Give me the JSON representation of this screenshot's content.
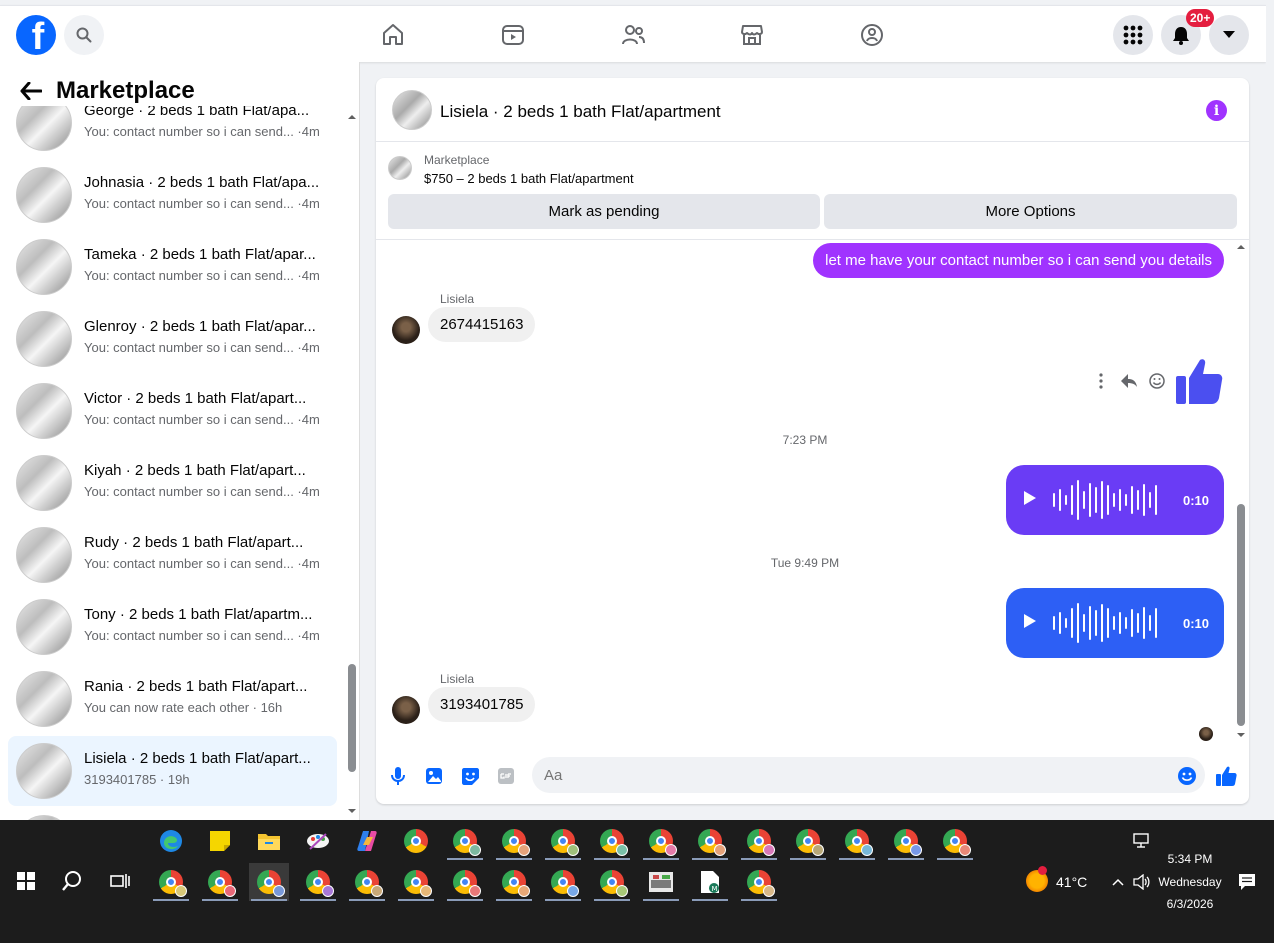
{
  "topbar": {
    "notification_badge": "20+",
    "icons": [
      "facebook-logo",
      "search-icon",
      "home-icon",
      "video-icon",
      "friends-icon",
      "marketplace-icon",
      "groups-icon",
      "menu-grid-icon",
      "bell-icon",
      "account-chevron-icon"
    ]
  },
  "sidebar": {
    "title": "Marketplace",
    "conversations": [
      {
        "name": "George · 2 beds 1 bath Flat/apa...",
        "preview": "You: contact number so i can send... ·4m"
      },
      {
        "name": "Johnasia · 2 beds 1 bath Flat/apa...",
        "preview": "You: contact number so i can send... ·4m"
      },
      {
        "name": "Tameka · 2 beds 1 bath Flat/apar...",
        "preview": "You: contact number so i can send... ·4m"
      },
      {
        "name": "Glenroy · 2 beds 1 bath Flat/apar...",
        "preview": "You: contact number so i can send... ·4m"
      },
      {
        "name": "Victor · 2 beds 1 bath Flat/apart...",
        "preview": "You: contact number so i can send... ·4m"
      },
      {
        "name": "Kiyah · 2 beds 1 bath Flat/apart...",
        "preview": "You: contact number so i can send... ·4m"
      },
      {
        "name": "Rudy · 2 beds 1 bath Flat/apart...",
        "preview": "You: contact number so i can send... ·4m"
      },
      {
        "name": "Tony · 2 beds 1 bath Flat/apartm...",
        "preview": "You: contact number so i can send... ·4m"
      },
      {
        "name": "Rania · 2 beds 1 bath Flat/apart...",
        "preview": "You can now rate each other · 16h"
      },
      {
        "name": "Lisiela · 2 beds 1 bath Flat/apart...",
        "preview": "3193401785 · 19h"
      }
    ]
  },
  "chat": {
    "title": "Lisiela · 2 beds 1 bath Flat/apartment",
    "listing": {
      "label": "Marketplace",
      "price_title": "$750 – 2 beds 1 bath Flat/apartment",
      "mark_pending": "Mark as pending",
      "more_options": "More Options"
    },
    "messages": {
      "out_text": "let me have your contact number so i can send you details",
      "sender1": "Lisiela",
      "in1": "2674415163",
      "time1": "7:23 PM",
      "voice1_duration": "0:10",
      "time2": "Tue 9:49 PM",
      "voice2_duration": "0:10",
      "sender2": "Lisiela",
      "in2": "3193401785"
    },
    "composer_placeholder": "Aa",
    "colors": {
      "accent": "#a033ff",
      "voice1": "#6a3cf5",
      "voice2": "#2d5ff5",
      "link": "#0866ff"
    }
  },
  "taskbar": {
    "temperature": "41°C",
    "time": "5:34 PM",
    "day": "Wednesday",
    "date": "6/3/2026"
  }
}
